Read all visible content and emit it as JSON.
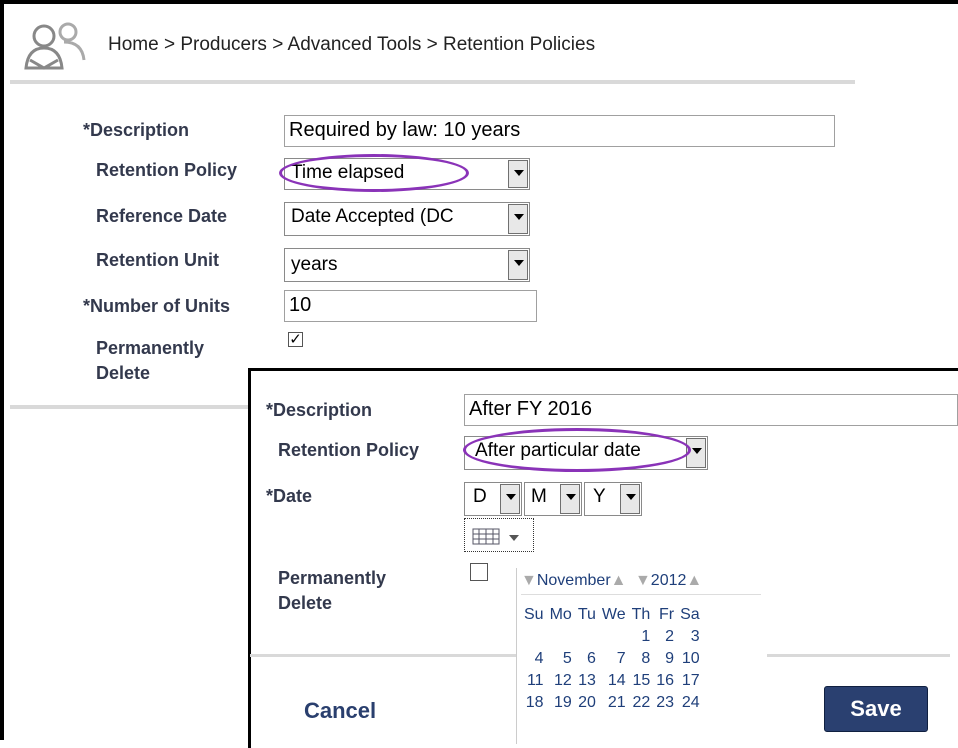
{
  "breadcrumb": "Home > Producers > Advanced Tools > Retention Policies",
  "form1": {
    "description_label": "*Description",
    "description_value": "Required by law: 10 years",
    "policy_label": "Retention Policy",
    "policy_value": "Time elapsed",
    "refdate_label": "Reference Date",
    "refdate_value": "Date Accepted (DC",
    "unit_label": "Retention Unit",
    "unit_value": "years",
    "units_label": "*Number of Units",
    "units_value": "10",
    "permdel_label_1": "Permanently",
    "permdel_label_2": "Delete",
    "permdel_checked": true
  },
  "form2": {
    "description_label": "*Description",
    "description_value": "After FY 2016",
    "policy_label": "Retention Policy",
    "policy_value": "After particular date",
    "date_label": "*Date",
    "day": "D",
    "month": "M",
    "year": "Y",
    "permdel_label_1": "Permanently",
    "permdel_label_2": "Delete",
    "permdel_checked": false,
    "cancel": "Cancel",
    "save": "Save"
  },
  "calendar": {
    "month": "November",
    "year": "2012",
    "weekdays": [
      "Su",
      "Mo",
      "Tu",
      "We",
      "Th",
      "Fr",
      "Sa"
    ],
    "weeks": [
      [
        "",
        "",
        "",
        "",
        "1",
        "2",
        "3"
      ],
      [
        "4",
        "5",
        "6",
        "7",
        "8",
        "9",
        "10"
      ],
      [
        "11",
        "12",
        "13",
        "14",
        "15",
        "16",
        "17"
      ],
      [
        "18",
        "19",
        "20",
        "21",
        "22",
        "23",
        "24"
      ]
    ]
  },
  "colors": {
    "accent_oval": "#8a33b8",
    "save_bg": "#2a4070"
  }
}
